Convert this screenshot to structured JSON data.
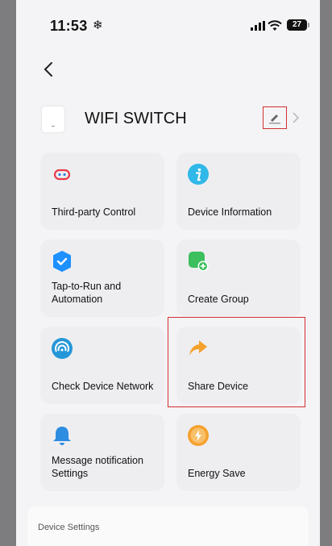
{
  "status_bar": {
    "time": "11:53",
    "weather_icon": "snowflake",
    "battery": "27"
  },
  "header": {
    "back_icon": "chevron-left"
  },
  "device": {
    "name": "WIFI SWITCH",
    "edit_icon": "pencil",
    "arrow_icon": "chevron-right"
  },
  "tiles": [
    {
      "label": "Third-party Control",
      "icon": "third-party-control-icon",
      "color": "#e8394a"
    },
    {
      "label": "Device Information",
      "icon": "info-icon",
      "color": "#2fb8e8"
    },
    {
      "label": "Tap-to-Run and Automation",
      "icon": "automation-icon",
      "color": "#1e90ff"
    },
    {
      "label": "Create Group",
      "icon": "group-add-icon",
      "color": "#3cbf5c"
    },
    {
      "label": "Check Device Network",
      "icon": "network-icon",
      "color": "#2596d8"
    },
    {
      "label": "Share Device",
      "icon": "share-arrow-icon",
      "color": "#f4a12e"
    },
    {
      "label": "Message notification Settings",
      "icon": "bell-icon",
      "color": "#2d8de0"
    },
    {
      "label": "Energy Save",
      "icon": "energy-icon",
      "color": "#f4a12e"
    }
  ],
  "section_title": "Device Settings"
}
